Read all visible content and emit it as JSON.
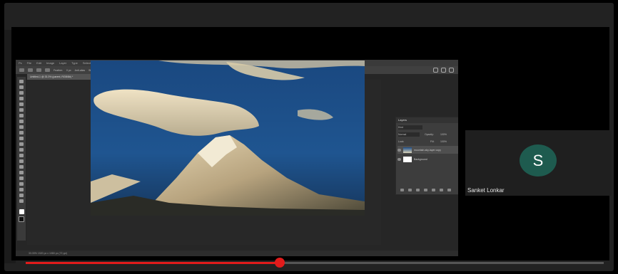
{
  "photoshop": {
    "menu": [
      "Ps",
      "File",
      "Edit",
      "Image",
      "Layer",
      "Type",
      "Select",
      "Filter",
      "3D",
      "View",
      "Plugins",
      "Window",
      "Help"
    ],
    "options": {
      "feather_label": "Feather:",
      "feather_value": "0 px",
      "anti_alias": "Anti-alias",
      "style_label": "Style:",
      "style_value": "Normal",
      "width_label": "Width:",
      "height_label": "Height:",
      "select_mask_label": "Select and Mask..."
    },
    "document_tab": "Untitled-1 @ 33.3% (parent, RGB/8#) *",
    "status": "33.33%     1920 px x 1080 px (72 ppi)",
    "layers_panel": {
      "title": "Layers",
      "kind_label": "Kind",
      "blend_mode": "Normal",
      "opacity_label": "Opacity:",
      "opacity_value": "100%",
      "lock_label": "Lock:",
      "fill_label": "Fill:",
      "fill_value": "100%",
      "layers": [
        {
          "name": "mountain-sky-layer copy",
          "selected": true
        },
        {
          "name": "Background",
          "selected": false
        }
      ]
    }
  },
  "participant": {
    "initial": "S",
    "name": "Sanket Lonkar",
    "avatar_color": "#1e5b4f"
  },
  "video": {
    "progress": 0.44,
    "progress_color": "#e21b1b"
  }
}
